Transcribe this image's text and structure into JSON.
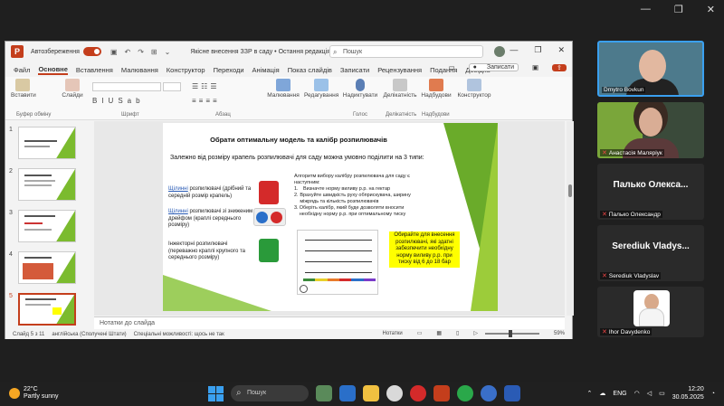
{
  "app": {
    "autosave_label": "Автозбереження",
    "doc_title": "Якісне внесення ЗЗР в саду • Остання редакція: Ср, 16:23",
    "search_placeholder": "Пошук",
    "menu": [
      "Файл",
      "Основне",
      "Вставлення",
      "Малювання",
      "Конструктор",
      "Переходи",
      "Анімація",
      "Показ слайдів",
      "Записати",
      "Рецензування",
      "Подання",
      "Довідка"
    ],
    "active_menu": "Основне",
    "record_label": "Записати",
    "ribbon": {
      "paste": "Вставити",
      "slides": "Слайди",
      "clipboard": "Буфер обміну",
      "font": "Шрифт",
      "paragraph": "Абзац",
      "drawing": "Малювання",
      "editing": "Редагування",
      "dictate": "Надиктувати",
      "voice": "Голос",
      "sensitivity": "Делікатність",
      "addins": "Надбудови",
      "designer": "Конструктор"
    },
    "notes_label": "Нотатки до слайда",
    "status": {
      "slide": "Слайд 5 з 11",
      "language": "англійська (Сполучені Штати)",
      "accessibility": "Спеціальні можливості: щось не так",
      "notes": "Нотатки",
      "zoom": "59%"
    }
  },
  "thumbnails": [
    {
      "num": "1",
      "selected": false
    },
    {
      "num": "2",
      "selected": false
    },
    {
      "num": "3",
      "selected": false
    },
    {
      "num": "4",
      "selected": false
    },
    {
      "num": "5",
      "selected": true
    }
  ],
  "slide": {
    "title": "Обрати оптимальну модель та калібр розпилювачів",
    "subtitle": "Залежно від розміру крапель розпилювачі для саду можна умовно поділити на 3 типи:",
    "type1_u": "Щілинні",
    "type1": " розпилювачі (дрібний та середній розмір крапель)",
    "type2_u": "Щілинні",
    "type2": " розпилювачі зі зниженим дрейфом (краплі середнього розміру)",
    "type3": "Інжекторні розпилювачі (переважно краплі крупного та середнього розміру)",
    "algo_intro": "Алгоритм вибору калібру розпилювача для саду є наступним:",
    "algo1": "Визначте норму виливу р.р. на гектар",
    "algo2": "Врахуйте швидкість руху обприскувача, ширину міжрядь та кількість розпилювачів",
    "algo3": "Оберіть калібр, який буде дозволяти вносити необхідну норму р.р. при оптимальному тиску",
    "note": "Обирайте для внесення розпилювачі, які здатні забезпечити необхідну норму виливу р.р. при тиску від 6 до 18 бар"
  },
  "participants": [
    {
      "name": "Dmytro Bovkun",
      "type": "video"
    },
    {
      "name": "Анастасія Маляріук",
      "type": "video"
    },
    {
      "name": "Палько Олекса...",
      "label": "Палько Олександр",
      "type": "text"
    },
    {
      "name": "Serediuk Vladys...",
      "label": "Serediuk Vladyslav",
      "type": "text"
    },
    {
      "name": "Ihor Davydenko",
      "type": "photo"
    }
  ],
  "taskbar": {
    "temp": "22°C",
    "weather": "Partly sunny",
    "search": "Пошук",
    "lang": "ENG",
    "time": "12:20",
    "date": "30.05.2025"
  },
  "colors": {
    "accent": "#c43e1c",
    "slide_green": "#6aab2a",
    "highlight": "#ffff00"
  }
}
